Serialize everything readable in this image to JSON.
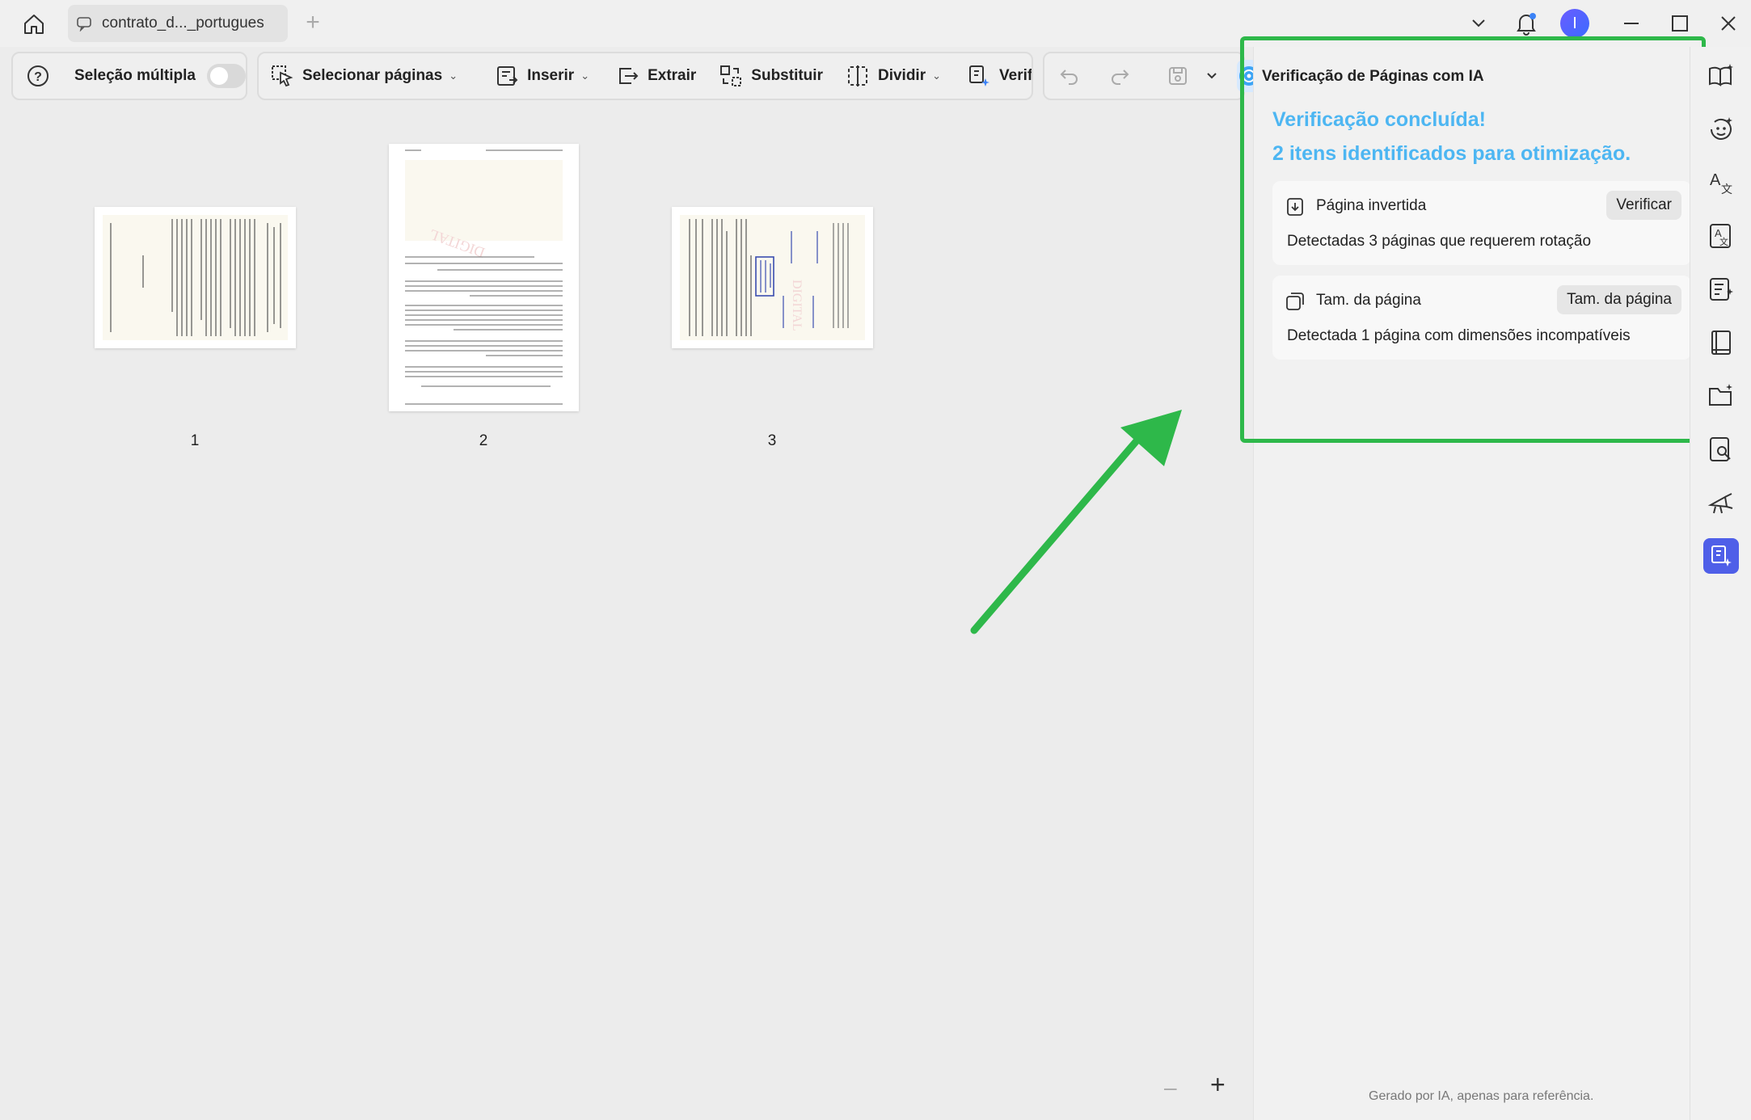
{
  "window": {
    "tab_title": "contrato_d..._portugues",
    "avatar_initial": "I"
  },
  "toolbar": {
    "multi_select_label": "Seleção múltipla",
    "select_pages_label": "Selecionar páginas",
    "insert_label": "Inserir",
    "extract_label": "Extrair",
    "replace_label": "Substituir",
    "split_label": "Dividir",
    "verify_label": "Verificaçã"
  },
  "pages": [
    {
      "number": "1"
    },
    {
      "number": "2"
    },
    {
      "number": "3"
    }
  ],
  "ai_panel": {
    "title": "Verificação de Páginas com IA",
    "status_line1": "Verificação concluída!",
    "status_line2": "2 itens identificados para otimização.",
    "cards": [
      {
        "title": "Página invertida",
        "button": "Verificar",
        "description": "Detectadas 3 páginas que requerem rotação"
      },
      {
        "title": "Tam. da página",
        "button": "Tam. da página",
        "description": "Detectada 1 página com dimensões incompatíveis"
      }
    ],
    "footer": "Gerado por IA, apenas para referência."
  },
  "colors": {
    "accent_blue": "#4db6f2",
    "highlight_green": "#2eb84a",
    "active_rail": "#4f5fe8"
  }
}
